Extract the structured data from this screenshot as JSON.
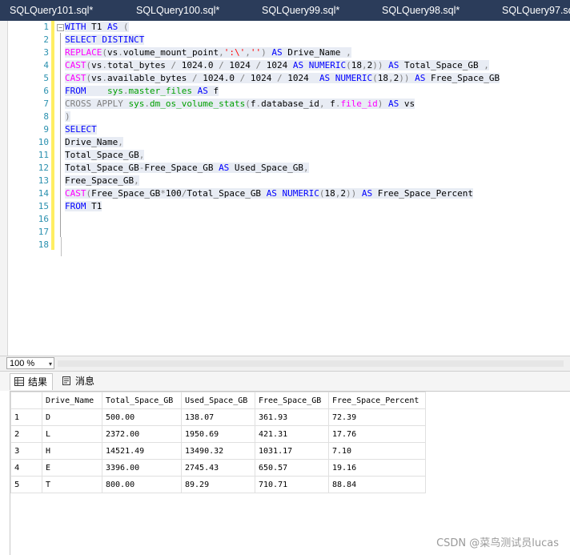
{
  "tabs": [
    {
      "label": "SQLQuery101.sql*"
    },
    {
      "label": "SQLQuery100.sql*"
    },
    {
      "label": "SQLQuery99.sql*"
    },
    {
      "label": "SQLQuery98.sql*"
    },
    {
      "label": "SQLQuery97.sq"
    }
  ],
  "editor": {
    "line_numbers": [
      "1",
      "2",
      "3",
      "4",
      "5",
      "6",
      "7",
      "8",
      "9",
      "10",
      "11",
      "12",
      "13",
      "14",
      "15",
      "16",
      "17",
      "18"
    ],
    "fold_glyph": "−",
    "lines": [
      [
        {
          "t": "WITH",
          "c": "kw"
        },
        {
          "t": " T1 ",
          "c": ""
        },
        {
          "t": "AS",
          "c": "kw"
        },
        {
          "t": " (",
          "c": "gr"
        }
      ],
      [
        {
          "t": "SELECT DISTINCT",
          "c": "kw"
        }
      ],
      [
        {
          "t": "REPLACE",
          "c": "fn"
        },
        {
          "t": "(",
          "c": "gr"
        },
        {
          "t": "vs",
          "c": ""
        },
        {
          "t": ".",
          "c": "gr"
        },
        {
          "t": "volume_mount_point",
          "c": ""
        },
        {
          "t": ",",
          "c": "gr"
        },
        {
          "t": "':\\'",
          "c": "str"
        },
        {
          "t": ",",
          "c": "gr"
        },
        {
          "t": "''",
          "c": "str"
        },
        {
          "t": ")",
          "c": "gr"
        },
        {
          "t": " AS",
          "c": "kw"
        },
        {
          "t": " Drive_Name ",
          "c": ""
        },
        {
          "t": ",",
          "c": "gr"
        }
      ],
      [
        {
          "t": "CAST",
          "c": "fn"
        },
        {
          "t": "(",
          "c": "gr"
        },
        {
          "t": "vs",
          "c": ""
        },
        {
          "t": ".",
          "c": "gr"
        },
        {
          "t": "total_bytes ",
          "c": ""
        },
        {
          "t": "/",
          "c": "gr"
        },
        {
          "t": " 1024.0 ",
          "c": ""
        },
        {
          "t": "/",
          "c": "gr"
        },
        {
          "t": " 1024 ",
          "c": ""
        },
        {
          "t": "/",
          "c": "gr"
        },
        {
          "t": " 1024 ",
          "c": ""
        },
        {
          "t": "AS NUMERIC",
          "c": "kw"
        },
        {
          "t": "(",
          "c": "gr"
        },
        {
          "t": "18",
          "c": ""
        },
        {
          "t": ",",
          "c": "gr"
        },
        {
          "t": "2",
          "c": ""
        },
        {
          "t": "))",
          "c": "gr"
        },
        {
          "t": " AS",
          "c": "kw"
        },
        {
          "t": " Total_Space_GB ",
          "c": ""
        },
        {
          "t": ",",
          "c": "gr"
        }
      ],
      [
        {
          "t": "CAST",
          "c": "fn"
        },
        {
          "t": "(",
          "c": "gr"
        },
        {
          "t": "vs",
          "c": ""
        },
        {
          "t": ".",
          "c": "gr"
        },
        {
          "t": "available_bytes ",
          "c": ""
        },
        {
          "t": "/",
          "c": "gr"
        },
        {
          "t": " 1024.0 ",
          "c": ""
        },
        {
          "t": "/",
          "c": "gr"
        },
        {
          "t": " 1024 ",
          "c": ""
        },
        {
          "t": "/",
          "c": "gr"
        },
        {
          "t": " 1024  ",
          "c": ""
        },
        {
          "t": "AS NUMERIC",
          "c": "kw"
        },
        {
          "t": "(",
          "c": "gr"
        },
        {
          "t": "18",
          "c": ""
        },
        {
          "t": ",",
          "c": "gr"
        },
        {
          "t": "2",
          "c": ""
        },
        {
          "t": "))",
          "c": "gr"
        },
        {
          "t": " AS",
          "c": "kw"
        },
        {
          "t": " Free_Space_GB",
          "c": ""
        }
      ],
      [
        {
          "t": "FROM",
          "c": "kw"
        },
        {
          "t": "    ",
          "c": ""
        },
        {
          "t": "sys",
          "c": "sys"
        },
        {
          "t": ".",
          "c": "gr"
        },
        {
          "t": "master_files",
          "c": "sys"
        },
        {
          "t": " AS",
          "c": "kw"
        },
        {
          "t": " f",
          "c": ""
        }
      ],
      [
        {
          "t": "CROSS APPLY",
          "c": "gr"
        },
        {
          "t": " sys",
          "c": "sys"
        },
        {
          "t": ".",
          "c": "gr"
        },
        {
          "t": "dm_os_volume_stats",
          "c": "sys"
        },
        {
          "t": "(",
          "c": "gr"
        },
        {
          "t": "f",
          "c": ""
        },
        {
          "t": ".",
          "c": "gr"
        },
        {
          "t": "database_id",
          "c": ""
        },
        {
          "t": ",",
          "c": "gr"
        },
        {
          "t": " f",
          "c": ""
        },
        {
          "t": ".",
          "c": "gr"
        },
        {
          "t": "file_id",
          "c": "fn"
        },
        {
          "t": ")",
          "c": "gr"
        },
        {
          "t": " AS",
          "c": "kw"
        },
        {
          "t": " vs",
          "c": ""
        }
      ],
      [
        {
          "t": ")",
          "c": "gr"
        }
      ],
      [
        {
          "t": "SELECT",
          "c": "kw"
        }
      ],
      [
        {
          "t": "Drive_Name",
          "c": ""
        },
        {
          "t": ",",
          "c": "gr"
        }
      ],
      [
        {
          "t": "Total_Space_GB",
          "c": ""
        },
        {
          "t": ",",
          "c": "gr"
        }
      ],
      [
        {
          "t": "Total_Space_GB",
          "c": ""
        },
        {
          "t": "-",
          "c": "gr"
        },
        {
          "t": "Free_Space_GB ",
          "c": ""
        },
        {
          "t": "AS",
          "c": "kw"
        },
        {
          "t": " Used_Space_GB",
          "c": ""
        },
        {
          "t": ",",
          "c": "gr"
        }
      ],
      [
        {
          "t": "Free_Space_GB",
          "c": ""
        },
        {
          "t": ",",
          "c": "gr"
        }
      ],
      [
        {
          "t": "CAST",
          "c": "fn"
        },
        {
          "t": "(",
          "c": "gr"
        },
        {
          "t": "Free_Space_GB",
          "c": ""
        },
        {
          "t": "*",
          "c": "gr"
        },
        {
          "t": "100",
          "c": ""
        },
        {
          "t": "/",
          "c": "gr"
        },
        {
          "t": "Total_Space_GB ",
          "c": ""
        },
        {
          "t": "AS NUMERIC",
          "c": "kw"
        },
        {
          "t": "(",
          "c": "gr"
        },
        {
          "t": "18",
          "c": ""
        },
        {
          "t": ",",
          "c": "gr"
        },
        {
          "t": "2",
          "c": ""
        },
        {
          "t": "))",
          "c": "gr"
        },
        {
          "t": " AS",
          "c": "kw"
        },
        {
          "t": " Free_Space_Percent",
          "c": ""
        }
      ],
      [
        {
          "t": "FROM",
          "c": "kw"
        },
        {
          "t": " T1",
          "c": ""
        }
      ],
      [],
      [],
      []
    ]
  },
  "zoom": {
    "value": "100 %",
    "arrow_icon": "▾"
  },
  "result_tabs": [
    {
      "label": "结果",
      "icon": "grid-icon"
    },
    {
      "label": "消息",
      "icon": "message-icon"
    }
  ],
  "results": {
    "columns": [
      "Drive_Name",
      "Total_Space_GB",
      "Used_Space_GB",
      "Free_Space_GB",
      "Free_Space_Percent"
    ],
    "rows": [
      {
        "n": "1",
        "cells": [
          "D",
          "500.00",
          "138.07",
          "361.93",
          "72.39"
        ]
      },
      {
        "n": "2",
        "cells": [
          "L",
          "2372.00",
          "1950.69",
          "421.31",
          "17.76"
        ]
      },
      {
        "n": "3",
        "cells": [
          "H",
          "14521.49",
          "13490.32",
          "1031.17",
          "7.10"
        ]
      },
      {
        "n": "4",
        "cells": [
          "E",
          "3396.00",
          "2745.43",
          "650.57",
          "19.16"
        ]
      },
      {
        "n": "5",
        "cells": [
          "T",
          "800.00",
          "89.29",
          "710.71",
          "88.84"
        ]
      }
    ]
  },
  "watermark": "CSDN @菜鸟测试员lucas"
}
